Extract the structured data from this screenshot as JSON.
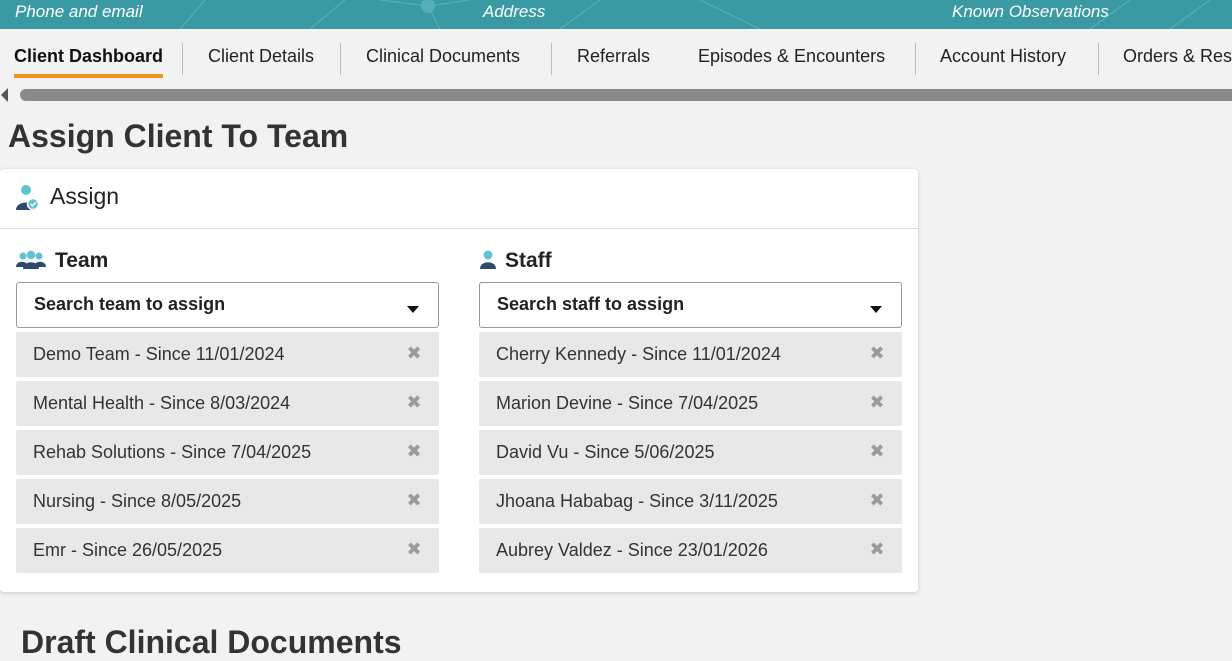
{
  "header": {
    "phone_email": "Phone and email",
    "address": "Address",
    "known_observations": "Known Observations"
  },
  "tabs": [
    {
      "label": "Client Dashboard",
      "active": true
    },
    {
      "label": "Client Details",
      "active": false
    },
    {
      "label": "Clinical Documents",
      "active": false
    },
    {
      "label": "Referrals",
      "active": false
    },
    {
      "label": "Episodes & Encounters",
      "active": false
    },
    {
      "label": "Account History",
      "active": false
    },
    {
      "label": "Orders & Res",
      "active": false
    }
  ],
  "page": {
    "title": "Assign Client To Team",
    "next_section_title": "Draft Clinical Documents"
  },
  "assign_card": {
    "title": "Assign",
    "icon": "user-check-icon",
    "team": {
      "title": "Team",
      "icon": "group-icon",
      "placeholder": "Search team to assign",
      "items": [
        "Demo Team - Since 11/01/2024",
        "Mental Health - Since 8/03/2024",
        "Rehab Solutions - Since 7/04/2025",
        "Nursing - Since 8/05/2025",
        "Emr - Since 26/05/2025"
      ]
    },
    "staff": {
      "title": "Staff",
      "icon": "user-icon",
      "placeholder": "Search staff to assign",
      "items": [
        "Cherry Kennedy - Since 11/01/2024",
        "Marion Devine - Since 7/04/2025",
        "David Vu - Since 5/06/2025",
        "Jhoana Hababag - Since 3/11/2025",
        "Aubrey Valdez - Since 23/01/2026"
      ]
    },
    "remove_glyph": "✖"
  },
  "colors": {
    "header_bg": "#3a9aa3",
    "active_tab_underline": "#f0931e",
    "icon_blue": "#2d4a6b",
    "icon_teal": "#5ec3d6"
  }
}
